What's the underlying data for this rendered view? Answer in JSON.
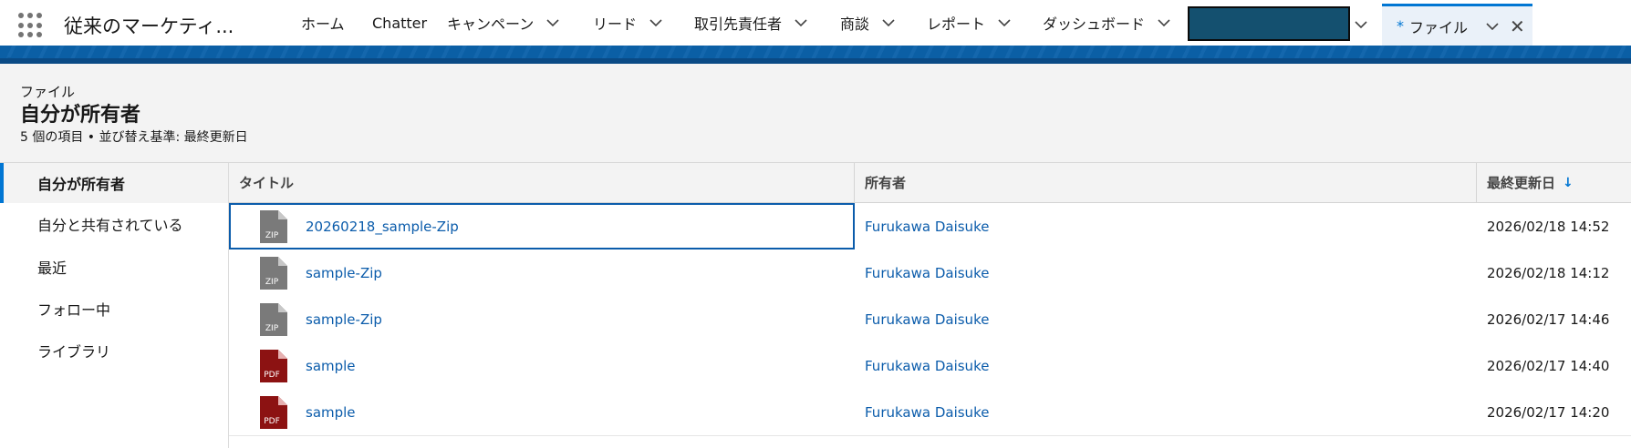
{
  "app": {
    "name": "従来のマーケティ..."
  },
  "nav": {
    "items": [
      {
        "label": "ホーム",
        "has_menu": false
      },
      {
        "label": "Chatter",
        "has_menu": false
      },
      {
        "label": "キャンペーン",
        "has_menu": true
      },
      {
        "label": "リード",
        "has_menu": true
      },
      {
        "label": "取引先責任者",
        "has_menu": true
      },
      {
        "label": "商談",
        "has_menu": true
      },
      {
        "label": "レポート",
        "has_menu": true
      },
      {
        "label": "ダッシュボード",
        "has_menu": true
      }
    ],
    "active_tab": {
      "modified_mark": "*",
      "label": "ファイル",
      "close": "✕"
    }
  },
  "header": {
    "object_label": "ファイル",
    "title": "自分が所有者",
    "subtitle": "5 個の項目 • 並び替え基準: 最終更新日"
  },
  "sidebar": {
    "items": [
      {
        "label": "自分が所有者",
        "active": true
      },
      {
        "label": "自分と共有されている",
        "active": false
      },
      {
        "label": "最近",
        "active": false
      },
      {
        "label": "フォロー中",
        "active": false
      },
      {
        "label": "ライブラリ",
        "active": false
      }
    ]
  },
  "table": {
    "columns": {
      "title": "タイトル",
      "owner": "所有者",
      "modified": "最終更新日",
      "sort_indicator": "↓"
    },
    "rows": [
      {
        "type": "ZIP",
        "title": "20260218_sample-Zip",
        "owner": "Furukawa Daisuke",
        "modified": "2026/02/18 14:52"
      },
      {
        "type": "ZIP",
        "title": "sample-Zip",
        "owner": "Furukawa Daisuke",
        "modified": "2026/02/18 14:12"
      },
      {
        "type": "ZIP",
        "title": "sample-Zip",
        "owner": "Furukawa Daisuke",
        "modified": "2026/02/17 14:46"
      },
      {
        "type": "PDF",
        "title": "sample",
        "owner": "Furukawa Daisuke",
        "modified": "2026/02/17 14:40"
      },
      {
        "type": "PDF",
        "title": "sample",
        "owner": "Furukawa Daisuke",
        "modified": "2026/02/17 14:20"
      }
    ]
  },
  "colors": {
    "brand": "#0176d3",
    "link": "#0b5cab",
    "zip_icon": "#7a7a7a",
    "pdf_icon": "#8c1212",
    "redacted_tab": "#14506f"
  },
  "icons": {
    "app_launcher": "waffle-icon",
    "menu": "chevron-down-icon",
    "close": "close-icon",
    "file_zip": "zip-file-icon",
    "file_pdf": "pdf-file-icon"
  }
}
